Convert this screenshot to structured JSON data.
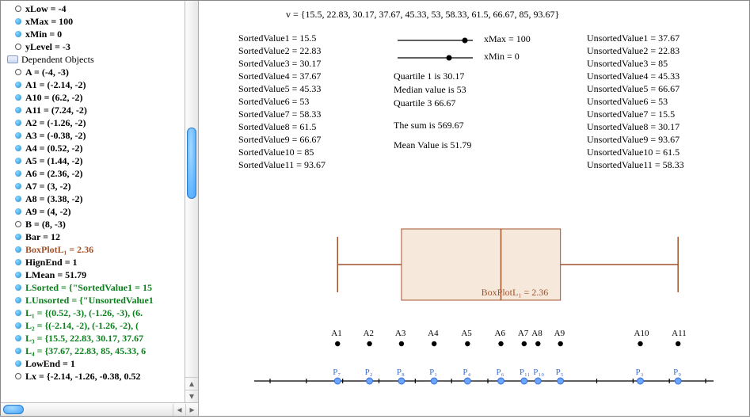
{
  "sidebar": {
    "top": [
      {
        "label": "xLow = -4",
        "bullet": "empty"
      },
      {
        "label": "xMax = 100",
        "bullet": "filled"
      },
      {
        "label": "xMin = 0",
        "bullet": "filled"
      },
      {
        "label": "yLevel = -3",
        "bullet": "empty"
      }
    ],
    "dep_header": "Dependent Objects",
    "dep": [
      {
        "label": "A = (-4, -3)",
        "bullet": "empty"
      },
      {
        "label": "A1 = (-2.14, -2)",
        "bullet": "filled"
      },
      {
        "label": "A10 = (6.2, -2)",
        "bullet": "filled"
      },
      {
        "label": "A11 = (7.24, -2)",
        "bullet": "filled"
      },
      {
        "label": "A2 = (-1.26, -2)",
        "bullet": "filled"
      },
      {
        "label": "A3 = (-0.38, -2)",
        "bullet": "filled"
      },
      {
        "label": "A4 = (0.52, -2)",
        "bullet": "filled"
      },
      {
        "label": "A5 = (1.44, -2)",
        "bullet": "filled"
      },
      {
        "label": "A6 = (2.36, -2)",
        "bullet": "filled"
      },
      {
        "label": "A7 = (3, -2)",
        "bullet": "filled"
      },
      {
        "label": "A8 = (3.38, -2)",
        "bullet": "filled"
      },
      {
        "label": "A9 = (4, -2)",
        "bullet": "filled"
      },
      {
        "label": "B = (8, -3)",
        "bullet": "empty"
      },
      {
        "label": "Bar = 12",
        "bullet": "filled"
      },
      {
        "label": "BoxPlotL₁ = 2.36",
        "bullet": "filled",
        "cls": "brown"
      },
      {
        "label": "HignEnd = 1",
        "bullet": "filled"
      },
      {
        "label": "LMean = 51.79",
        "bullet": "filled"
      },
      {
        "label": "LSorted = {\"SortedValue1 = 15",
        "bullet": "filled",
        "cls": "green"
      },
      {
        "label": "LUnsorted = {\"UnsortedValue1",
        "bullet": "filled",
        "cls": "green"
      },
      {
        "label": "L₁ = {(0.52, -3), (-1.26, -3), (6.",
        "bullet": "filled",
        "cls": "green"
      },
      {
        "label": "L₂ = {(-2.14, -2), (-1.26, -2), (",
        "bullet": "filled",
        "cls": "green"
      },
      {
        "label": "L₃ = {15.5, 22.83, 30.17, 37.67",
        "bullet": "filled",
        "cls": "green"
      },
      {
        "label": "L₄ = {37.67, 22.83, 85, 45.33, 6",
        "bullet": "filled",
        "cls": "green"
      },
      {
        "label": "LowEnd = 1",
        "bullet": "filled"
      },
      {
        "label": "Lx = {-2.14, -1.26, -0.38, 0.52",
        "bullet": "empty"
      }
    ]
  },
  "canvas": {
    "header": "v = {15.5, 22.83, 30.17, 37.67, 45.33, 53, 58.33, 61.5, 66.67, 85, 93.67}",
    "sorted": [
      "SortedValue1 = 15.5",
      "SortedValue2 = 22.83",
      "SortedValue3 = 30.17",
      "SortedValue4 = 37.67",
      "SortedValue5 = 45.33",
      "SortedValue6 = 53",
      "SortedValue7 = 58.33",
      "SortedValue8 = 61.5",
      "SortedValue9 = 66.67",
      "SortedValue10 = 85",
      "SortedValue11 = 93.67"
    ],
    "stats": {
      "xmax": "xMax = 100",
      "xmin": "xMin = 0",
      "q1": "Quartile 1 is 30.17",
      "med": "Median value is 53",
      "q3": "Quartile 3 66.67",
      "sum": "The sum is 569.67",
      "mean": "Mean Value is 51.79"
    },
    "unsorted": [
      "UnsortedValue1 = 37.67",
      "UnsortedValue2 = 22.83",
      "UnsortedValue3 = 85",
      "UnsortedValue4 = 45.33",
      "UnsortedValue5 = 66.67",
      "UnsortedValue6 = 53",
      "UnsortedValue7 = 15.5",
      "UnsortedValue8 = 30.17",
      "UnsortedValue9 = 93.67",
      "UnsortedValue10 = 61.5",
      "UnsortedValue11 = 58.33"
    ],
    "boxlabel": "BoxPlotL₁ = 2.36"
  },
  "chart_data": {
    "type": "box-and-strip",
    "title": "",
    "boxplot": {
      "xmin": 0,
      "xmax": 100,
      "whisker_low": 15.5,
      "q1": 30.17,
      "median": 53,
      "q3": 66.67,
      "whisker_high": 93.67
    },
    "black_points": [
      {
        "label": "A1",
        "x": -2.14
      },
      {
        "label": "A2",
        "x": -1.26
      },
      {
        "label": "A3",
        "x": -0.38
      },
      {
        "label": "A4",
        "x": 0.52
      },
      {
        "label": "A5",
        "x": 1.44
      },
      {
        "label": "A6",
        "x": 2.36
      },
      {
        "label": "A7",
        "x": 3
      },
      {
        "label": "A8",
        "x": 3.38
      },
      {
        "label": "A9",
        "x": 4
      },
      {
        "label": "A10",
        "x": 6.2
      },
      {
        "label": "A11",
        "x": 7.24
      }
    ],
    "blue_points": [
      {
        "label": "P₇",
        "x": -2.14
      },
      {
        "label": "P₂",
        "x": -1.26
      },
      {
        "label": "P₈",
        "x": -0.38
      },
      {
        "label": "P₁",
        "x": 0.52
      },
      {
        "label": "P₄",
        "x": 1.44
      },
      {
        "label": "P₆",
        "x": 2.36
      },
      {
        "label": "P₁₁",
        "x": 3
      },
      {
        "label": "P₁₀",
        "x": 3.38
      },
      {
        "label": "P₅",
        "x": 4
      },
      {
        "label": "P₃",
        "x": 6.2
      },
      {
        "label": "P₉",
        "x": 7.24
      }
    ],
    "axis_range": [
      -4,
      8
    ]
  }
}
